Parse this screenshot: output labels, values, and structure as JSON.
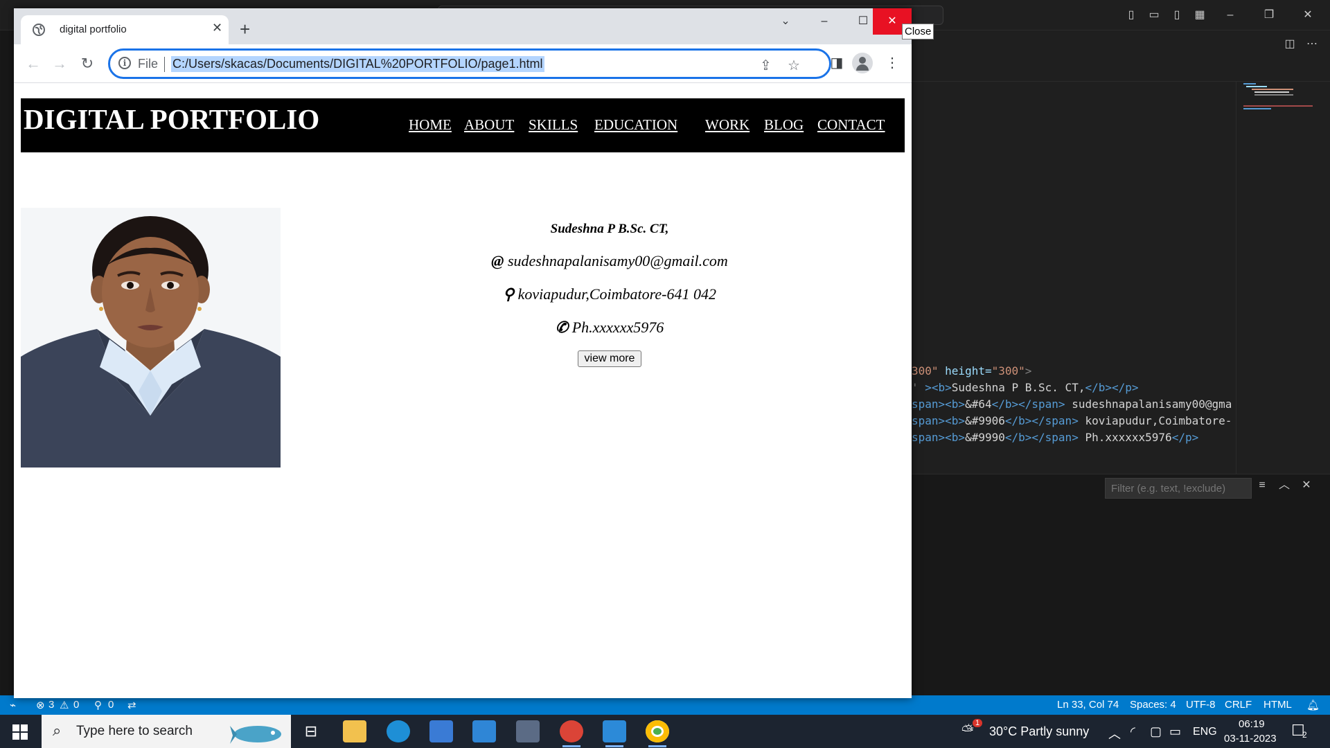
{
  "vscode": {
    "code_lines": [
      {
        "parts": [
          [
            "str",
            "300\""
          ],
          [
            "attr",
            " height="
          ],
          [
            "str",
            "\"300\""
          ],
          [
            "punc",
            ">"
          ]
        ]
      },
      {
        "parts": [
          [
            "punc",
            "' "
          ],
          [
            "tag",
            "><b>"
          ],
          [
            "txt",
            "Sudeshna P B.Sc. CT,"
          ],
          [
            "tag",
            "</b></p>"
          ]
        ]
      },
      {
        "parts": [
          [
            "tag",
            "span><b>"
          ],
          [
            "txt",
            "&#64"
          ],
          [
            "tag",
            "</b></span>"
          ],
          [
            "txt",
            " sudeshnapalanisamy00@gma"
          ]
        ]
      },
      {
        "parts": [
          [
            "tag",
            "span><b>"
          ],
          [
            "txt",
            "&#9906"
          ],
          [
            "tag",
            "</b></span>"
          ],
          [
            "txt",
            " koviapudur,Coimbatore-"
          ]
        ]
      },
      {
        "parts": [
          [
            "tag",
            "span><b>"
          ],
          [
            "txt",
            "&#9990"
          ],
          [
            "tag",
            "</b></span>"
          ],
          [
            "txt",
            " Ph.xxxxxx5976"
          ],
          [
            "tag",
            "</p>"
          ]
        ]
      }
    ],
    "filter_placeholder": "Filter (e.g. text, !exclude)",
    "status": {
      "errors": "3",
      "warnings": "0",
      "ports": "0",
      "position": "Ln 33, Col 74",
      "spaces": "Spaces: 4",
      "encoding": "UTF-8",
      "eol": "CRLF",
      "language": "HTML"
    }
  },
  "browser": {
    "tab_title": "digital portfolio",
    "file_label": "File",
    "url": "C:/Users/skacas/Documents/DIGITAL%20PORTFOLIO/page1.html",
    "close_tooltip": "Close"
  },
  "page": {
    "site_title": "DIGITAL PORTFOLIO",
    "nav": [
      "HOME",
      "ABOUT",
      "SKILLS",
      "EDUCATION",
      "WORK",
      "BLOG",
      "CONTACT"
    ],
    "name": "Sudeshna P B.Sc. CT,",
    "email_symbol": "@",
    "email": "sudeshnapalanisamy00@gmail.com",
    "location_symbol": "⚲",
    "location": "koviapudur,Coimbatore-641 042",
    "phone_symbol": "✆",
    "phone": "Ph.xxxxxx5976",
    "button": "view more"
  },
  "taskbar": {
    "search_placeholder": "Type here to search",
    "weather": "30°C  Partly sunny",
    "weather_badge": "1",
    "language": "ENG",
    "time": "06:19",
    "date": "03-11-2023",
    "notifications": "2"
  },
  "colors": {
    "accent_blue": "#1a73e8",
    "status_bar": "#007acc",
    "close_red": "#e81123",
    "header_black": "#000000"
  }
}
